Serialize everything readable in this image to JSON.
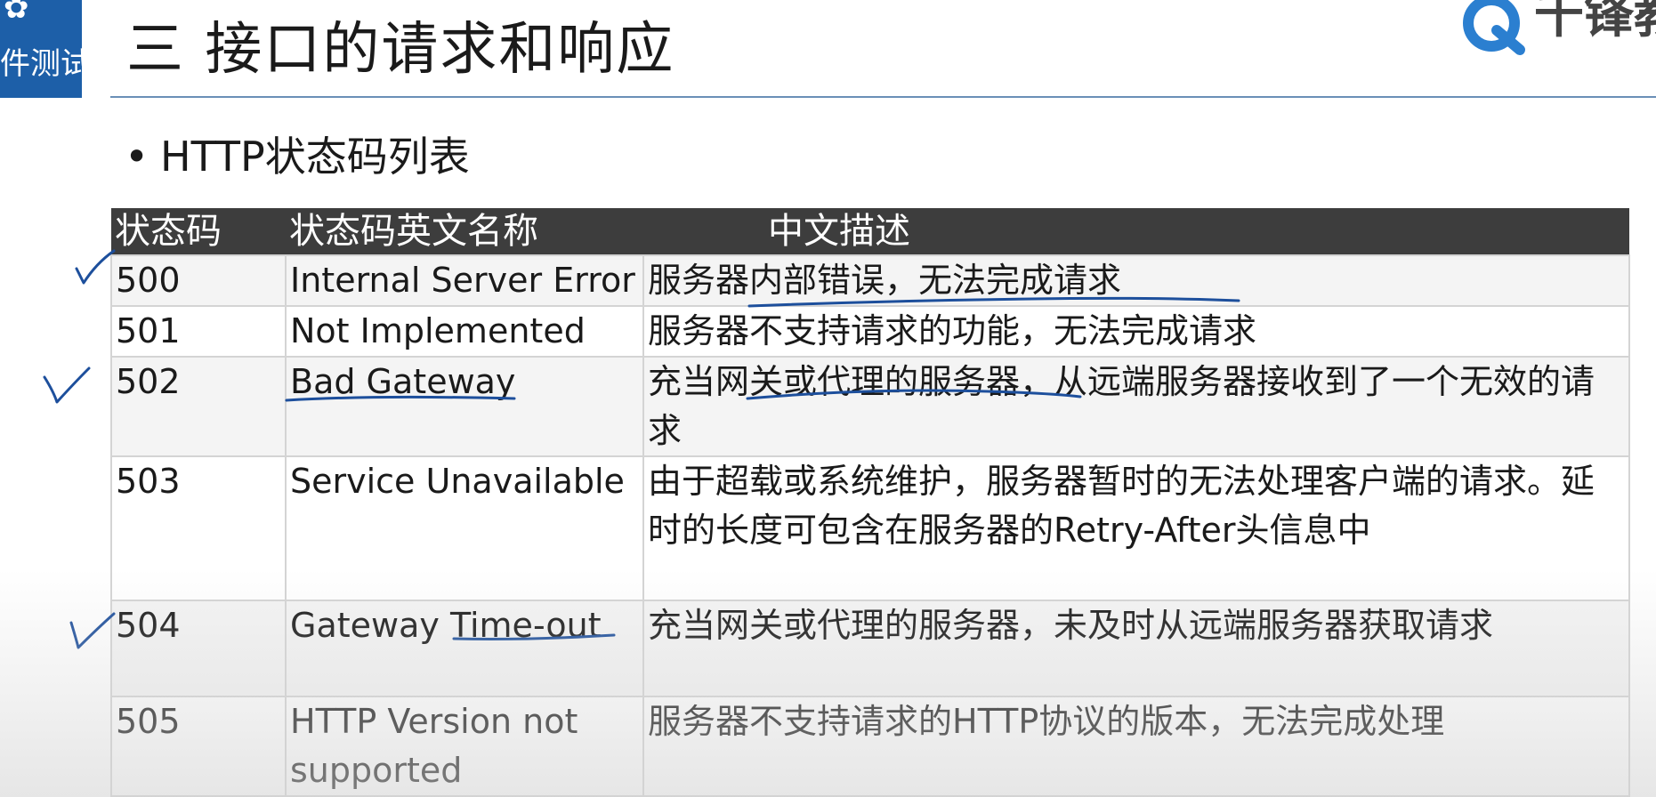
{
  "header": {
    "badge_text": "件测试",
    "title": "三  接口的请求和响应",
    "logo_text": "千锋教"
  },
  "bullet": "HTTP状态码列表",
  "table": {
    "headers": [
      "状态码",
      "状态码英文名称",
      "中文描述"
    ],
    "rows": [
      {
        "code": "500",
        "name": "Internal Server Error",
        "desc": "服务器内部错误，无法完成请求"
      },
      {
        "code": "501",
        "name": "Not Implemented",
        "desc": "服务器不支持请求的功能，无法完成请求"
      },
      {
        "code": "502",
        "name": "Bad Gateway",
        "desc": "充当网关或代理的服务器，从远端服务器接收到了一个无效的请求"
      },
      {
        "code": "503",
        "name": "Service Unavailable",
        "desc": "由于超载或系统维护，服务器暂时的无法处理客户端的请求。延时的长度可包含在服务器的Retry-After头信息中"
      },
      {
        "code": "504",
        "name": "Gateway Time-out",
        "desc": "充当网关或代理的服务器，未及时从远端服务器获取请求"
      },
      {
        "code": "505",
        "name": "HTTP Version not supported",
        "desc": "服务器不支持请求的HTTP协议的版本，无法完成处理"
      }
    ]
  },
  "colors": {
    "badge_bg": "#1d5fa8",
    "header_bg": "#3d3d3d",
    "ink": "#1d4f9c",
    "rule": "#6a8fb7"
  }
}
